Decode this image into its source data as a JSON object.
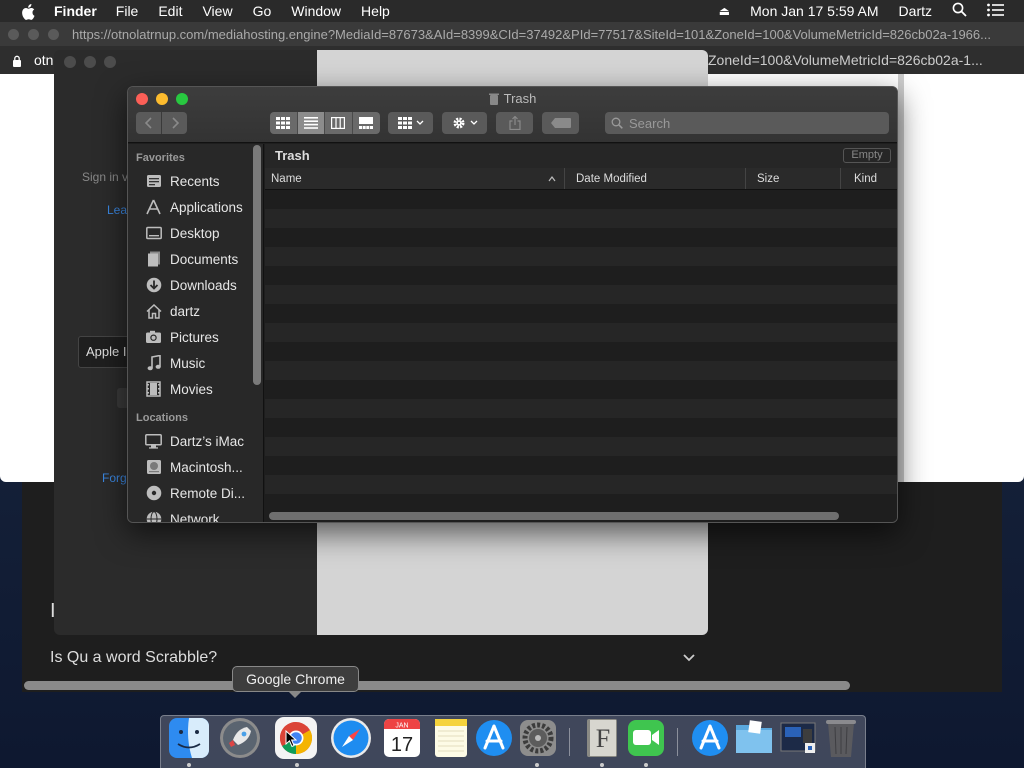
{
  "menubar": {
    "app_name": "Finder",
    "items": [
      "File",
      "Edit",
      "View",
      "Go",
      "Window",
      "Help"
    ],
    "clock": "Mon Jan 17  5:59 AM",
    "user": "Dartz"
  },
  "browser": {
    "url": "https://otnolatrnup.com/mediahosting.engine?MediaId=87673&AId=8399&CId=37492&PId=77517&SiteId=101&ZoneId=100&VolumeMetricId=826cb02a-1966...",
    "tab_left": "otn",
    "tab_right_url": "ZoneId=100&VolumeMetricId=826cb02a-1..."
  },
  "signin": {
    "text1": "Sign in v",
    "text2": "Lea",
    "field": "Apple I",
    "text3": "Forg"
  },
  "webpage": {
    "faq_letter": "I",
    "faq_question": "Is Qu a word Scrabble?"
  },
  "finder": {
    "title": "Trash",
    "search_placeholder": "Search",
    "breadcrumb": "Trash",
    "empty_button": "Empty",
    "columns": {
      "name": "Name",
      "date": "Date Modified",
      "size": "Size",
      "kind": "Kind"
    },
    "sidebar": {
      "favorites_header": "Favorites",
      "favorites": [
        {
          "label": "Recents",
          "icon": "recents-icon"
        },
        {
          "label": "Applications",
          "icon": "applications-icon"
        },
        {
          "label": "Desktop",
          "icon": "desktop-icon"
        },
        {
          "label": "Documents",
          "icon": "documents-icon"
        },
        {
          "label": "Downloads",
          "icon": "downloads-icon"
        },
        {
          "label": "dartz",
          "icon": "home-icon"
        },
        {
          "label": "Pictures",
          "icon": "pictures-icon"
        },
        {
          "label": "Music",
          "icon": "music-icon"
        },
        {
          "label": "Movies",
          "icon": "movies-icon"
        }
      ],
      "locations_header": "Locations",
      "locations": [
        {
          "label": "Dartz’s iMac",
          "icon": "imac-icon"
        },
        {
          "label": "Macintosh...",
          "icon": "disk-icon"
        },
        {
          "label": "Remote Di...",
          "icon": "remote-disc-icon"
        },
        {
          "label": "Network",
          "icon": "network-icon"
        }
      ]
    }
  },
  "tooltip": "Google Chrome",
  "dock": {
    "apps": [
      {
        "name": "Finder",
        "icon": "finder-icon",
        "running": true
      },
      {
        "name": "Launchpad",
        "icon": "launchpad-icon",
        "running": false
      },
      {
        "name": "Google Chrome",
        "icon": "chrome-icon",
        "running": true
      },
      {
        "name": "Safari",
        "icon": "safari-icon",
        "running": false
      },
      {
        "name": "Calendar",
        "icon": "calendar-icon",
        "running": false,
        "month": "JAN",
        "day": "17"
      },
      {
        "name": "Notes",
        "icon": "notes-icon",
        "running": false
      },
      {
        "name": "App Store",
        "icon": "app-store-icon",
        "running": false
      },
      {
        "name": "System Preferences",
        "icon": "system-preferences-icon",
        "running": true
      },
      {
        "name": "Font Book",
        "icon": "font-book-icon",
        "running": true,
        "letter": "F"
      },
      {
        "name": "FaceTime",
        "icon": "facetime-icon",
        "running": true
      },
      {
        "name": "Applications",
        "icon": "applications-folder-icon",
        "running": false
      },
      {
        "name": "Documents",
        "icon": "documents-folder-icon",
        "running": false
      },
      {
        "name": "Screenshots",
        "icon": "screenshot-stack-icon",
        "running": false
      },
      {
        "name": "Trash",
        "icon": "trash-icon",
        "running": false
      }
    ]
  },
  "colors": {
    "close": "#fc5f57",
    "minimize": "#fdbc2e",
    "zoom": "#28c840",
    "link": "#3a86e0"
  }
}
